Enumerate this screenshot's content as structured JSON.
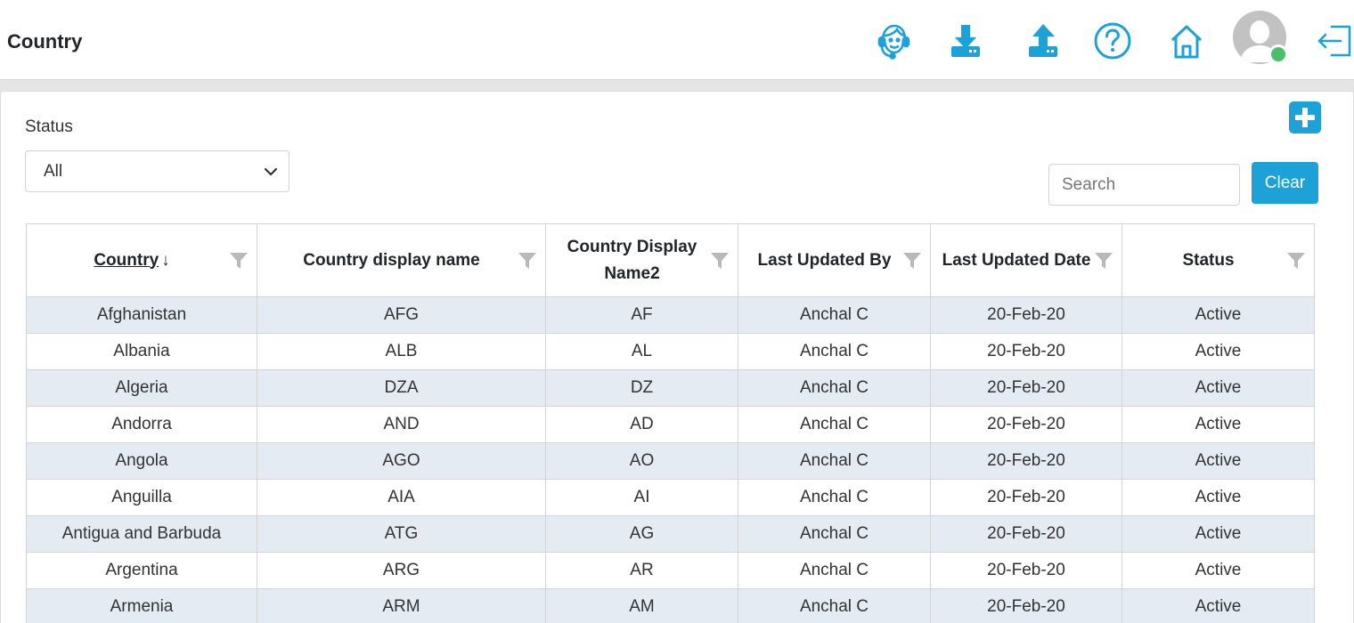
{
  "header": {
    "title": "Country",
    "icons": [
      "support-agent-icon",
      "download-icon",
      "upload-icon",
      "help-icon",
      "home-icon",
      "avatar-icon",
      "logout-icon"
    ],
    "icon_color": "#1ea1d6",
    "online_color": "#4cbe6c"
  },
  "filters": {
    "status_label": "Status",
    "status_value": "All",
    "search_placeholder": "Search",
    "clear_label": "Clear",
    "add_icon": "plus-icon"
  },
  "table": {
    "columns": [
      "Country",
      "Country display name",
      "Country Display Name2",
      "Last Updated By",
      "Last Updated Date",
      "Status"
    ],
    "sort_column": "Country",
    "sort_arrow": "↓",
    "row_stripe_color": "#e5ebf2",
    "rows": [
      [
        "Afghanistan",
        "AFG",
        "AF",
        "Anchal C",
        "20-Feb-20",
        "Active"
      ],
      [
        "Albania",
        "ALB",
        "AL",
        "Anchal C",
        "20-Feb-20",
        "Active"
      ],
      [
        "Algeria",
        "DZA",
        "DZ",
        "Anchal C",
        "20-Feb-20",
        "Active"
      ],
      [
        "Andorra",
        "AND",
        "AD",
        "Anchal C",
        "20-Feb-20",
        "Active"
      ],
      [
        "Angola",
        "AGO",
        "AO",
        "Anchal C",
        "20-Feb-20",
        "Active"
      ],
      [
        "Anguilla",
        "AIA",
        "AI",
        "Anchal C",
        "20-Feb-20",
        "Active"
      ],
      [
        "Antigua and Barbuda",
        "ATG",
        "AG",
        "Anchal C",
        "20-Feb-20",
        "Active"
      ],
      [
        "Argentina",
        "ARG",
        "AR",
        "Anchal C",
        "20-Feb-20",
        "Active"
      ],
      [
        "Armenia",
        "ARM",
        "AM",
        "Anchal C",
        "20-Feb-20",
        "Active"
      ]
    ]
  }
}
